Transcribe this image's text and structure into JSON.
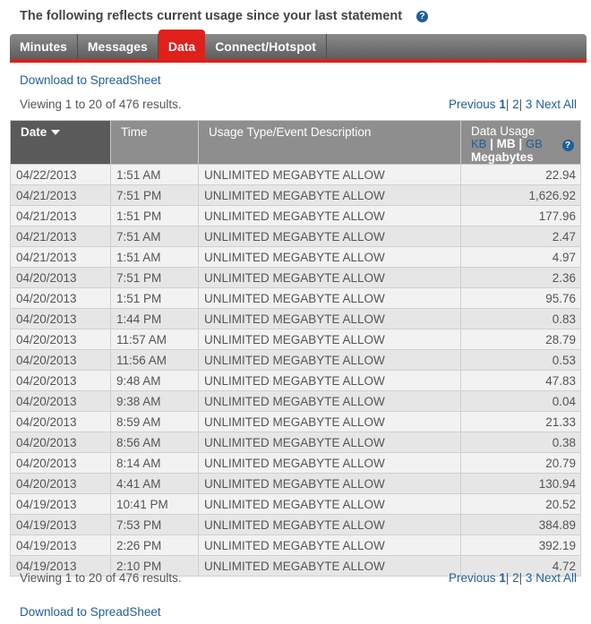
{
  "header": {
    "text": "The following reflects current usage since your last statement",
    "help": "?"
  },
  "tabs": [
    "Minutes",
    "Messages",
    "Data",
    "Connect/Hotspot"
  ],
  "active_tab": "Data",
  "download_label": "Download to SpreadSheet",
  "viewing_text": "Viewing 1 to 20 of 476 results.",
  "pager": {
    "previous": "Previous",
    "p1": "1",
    "p2": "2",
    "p3": "3",
    "next": "Next",
    "all": "All",
    "sep": "|"
  },
  "columns": {
    "date": "Date",
    "time": "Time",
    "type": "Usage Type/Event Description",
    "usage": "Data Usage",
    "kb": "KB",
    "mb": "MB",
    "gb": "GB",
    "unit_label": "Megabytes",
    "sep": "|"
  },
  "rows": [
    {
      "date": "04/22/2013",
      "time": "1:51 AM",
      "type": "UNLIMITED MEGABYTE ALLOW",
      "usage": "22.94"
    },
    {
      "date": "04/21/2013",
      "time": "7:51 PM",
      "type": "UNLIMITED MEGABYTE ALLOW",
      "usage": "1,626.92"
    },
    {
      "date": "04/21/2013",
      "time": "1:51 PM",
      "type": "UNLIMITED MEGABYTE ALLOW",
      "usage": "177.96"
    },
    {
      "date": "04/21/2013",
      "time": "7:51 AM",
      "type": "UNLIMITED MEGABYTE ALLOW",
      "usage": "2.47"
    },
    {
      "date": "04/21/2013",
      "time": "1:51 AM",
      "type": "UNLIMITED MEGABYTE ALLOW",
      "usage": "4.97"
    },
    {
      "date": "04/20/2013",
      "time": "7:51 PM",
      "type": "UNLIMITED MEGABYTE ALLOW",
      "usage": "2.36"
    },
    {
      "date": "04/20/2013",
      "time": "1:51 PM",
      "type": "UNLIMITED MEGABYTE ALLOW",
      "usage": "95.76"
    },
    {
      "date": "04/20/2013",
      "time": "1:44 PM",
      "type": "UNLIMITED MEGABYTE ALLOW",
      "usage": "0.83"
    },
    {
      "date": "04/20/2013",
      "time": "11:57 AM",
      "type": "UNLIMITED MEGABYTE ALLOW",
      "usage": "28.79"
    },
    {
      "date": "04/20/2013",
      "time": "11:56 AM",
      "type": "UNLIMITED MEGABYTE ALLOW",
      "usage": "0.53"
    },
    {
      "date": "04/20/2013",
      "time": "9:48 AM",
      "type": "UNLIMITED MEGABYTE ALLOW",
      "usage": "47.83"
    },
    {
      "date": "04/20/2013",
      "time": "9:38 AM",
      "type": "UNLIMITED MEGABYTE ALLOW",
      "usage": "0.04"
    },
    {
      "date": "04/20/2013",
      "time": "8:59 AM",
      "type": "UNLIMITED MEGABYTE ALLOW",
      "usage": "21.33"
    },
    {
      "date": "04/20/2013",
      "time": "8:56 AM",
      "type": "UNLIMITED MEGABYTE ALLOW",
      "usage": "0.38"
    },
    {
      "date": "04/20/2013",
      "time": "8:14 AM",
      "type": "UNLIMITED MEGABYTE ALLOW",
      "usage": "20.79"
    },
    {
      "date": "04/20/2013",
      "time": "4:41 AM",
      "type": "UNLIMITED MEGABYTE ALLOW",
      "usage": "130.94"
    },
    {
      "date": "04/19/2013",
      "time": "10:41 PM",
      "type": "UNLIMITED MEGABYTE ALLOW",
      "usage": "20.52"
    },
    {
      "date": "04/19/2013",
      "time": "7:53 PM",
      "type": "UNLIMITED MEGABYTE ALLOW",
      "usage": "384.89"
    },
    {
      "date": "04/19/2013",
      "time": "2:26 PM",
      "type": "UNLIMITED MEGABYTE ALLOW",
      "usage": "392.19"
    },
    {
      "date": "04/19/2013",
      "time": "2:10 PM",
      "type": "UNLIMITED MEGABYTE ALLOW",
      "usage": "4.72"
    }
  ]
}
